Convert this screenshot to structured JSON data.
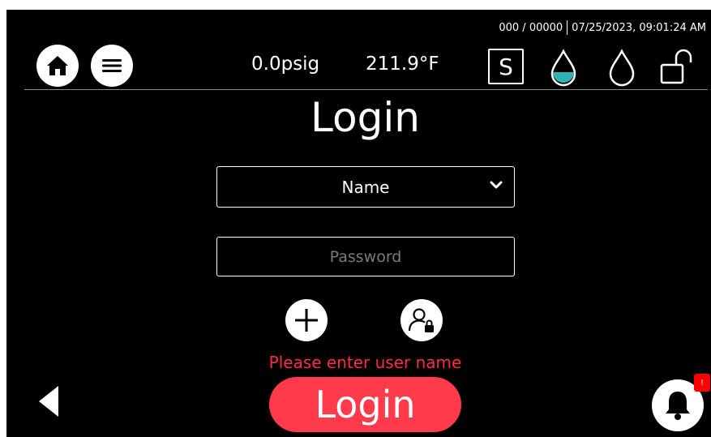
{
  "header": {
    "counter": "000 / 00000",
    "datetime": "07/25/2023, 09:01:24 AM",
    "pressure": "0.0psig",
    "temperature": "211.9°F",
    "mode_letter": "S"
  },
  "login": {
    "title": "Login",
    "name_select_value": "Name",
    "password_placeholder": "Password",
    "error_message": "Please enter user name",
    "login_button_label": "Login"
  },
  "notifications": {
    "badge": "!"
  },
  "colors": {
    "background": "#000000",
    "accent": "#ff3a4a",
    "error": "#ff2d3f",
    "water_fill": "#2fb3b3",
    "badge": "#ff0000"
  },
  "icons": {
    "home": "home-icon",
    "menu": "menu-icon",
    "water_full": "water-drop-filled-icon",
    "water_empty": "water-drop-empty-icon",
    "lock": "unlock-icon",
    "add_user": "plus-icon",
    "user_lock": "user-lock-icon",
    "back": "back-arrow-icon",
    "bell": "bell-icon"
  }
}
